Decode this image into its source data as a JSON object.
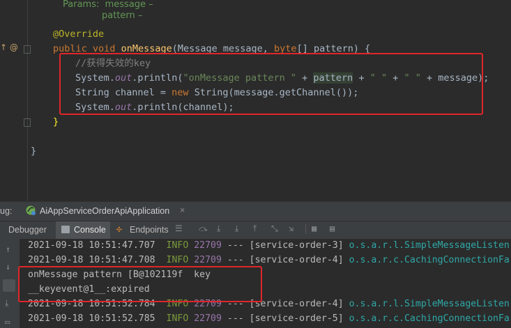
{
  "editor": {
    "doc_params_label": "Params:",
    "doc_param1": "message –",
    "doc_param2": "pattern –",
    "annotation": "@Override",
    "method_sig": {
      "public": "public",
      "void": "void",
      "name": "onMessage",
      "open": "(Message message, ",
      "byte": "byte",
      "rest": "[] pattern) {"
    },
    "comment": "//获得失效的key",
    "line2": {
      "a": "System.",
      "out": "out",
      "b": ".println(",
      "s1": "\"onMessage pattern \"",
      "c": " + ",
      "pattern": "pattern",
      "d": " + ",
      "s2": "\" \"",
      "e": " + ",
      "s3": "\" \"",
      "f": " + message);"
    },
    "line3": {
      "a": "String channel = ",
      "new": "new",
      "b": " String(message.getChannel());"
    },
    "line4": {
      "a": "System.",
      "out": "out",
      "b": ".println(channel);"
    },
    "close_brace": "}",
    "class_brace": "}",
    "gutter_marks": "↑ @"
  },
  "debug": {
    "title_prefix": "ug:",
    "config_name": "AiAppServiceOrderApiApplication",
    "close": "×",
    "tabs": [
      "Debugger",
      "Console",
      "Endpoints"
    ]
  },
  "console": {
    "lines": [
      {
        "ts": "2021-09-18 10:51:47.707",
        "level": "INFO",
        "pid": "22709",
        "sep": "---",
        "thread": "[service-order-3]",
        "logger": "o.s.a.r.l.SimpleMessageListen"
      },
      {
        "ts": "2021-09-18 10:51:47.708",
        "level": "INFO",
        "pid": "22709",
        "sep": "---",
        "thread": "[service-order-4]",
        "logger": "o.s.a.r.c.CachingConnectionFa"
      },
      {
        "plain": "onMessage pattern [B@102119f  key"
      },
      {
        "plain": "__keyevent@1__:expired"
      },
      {
        "ts": "2021-09-18 10:51:52.784",
        "level": "INFO",
        "pid": "22709",
        "sep": "---",
        "thread": "[service-order-4]",
        "logger": "o.s.a.r.l.SimpleMessageListen"
      },
      {
        "ts": "2021-09-18 10:51:52.785",
        "level": "INFO",
        "pid": "22709",
        "sep": "---",
        "thread": "[service-order-5]",
        "logger": "o.s.a.r.c.CachingConnectionFa"
      }
    ]
  },
  "colors": {
    "editor_bg": "#2b2b2b",
    "panel_bg": "#3c3f41",
    "highlight": "#e0262a",
    "keyword": "#cc7832",
    "method": "#ffc66d",
    "string": "#6a8759"
  }
}
